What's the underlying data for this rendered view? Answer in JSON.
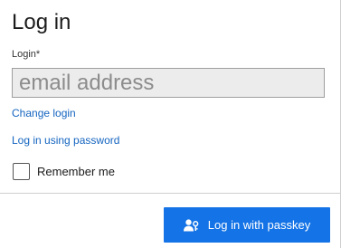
{
  "form": {
    "title": "Log in",
    "login_label": "Login*",
    "login_value": "",
    "login_placeholder": "email address",
    "change_login_link": "Change login",
    "password_link": "Log in using password",
    "remember_me_label": "Remember me",
    "remember_me_checked": false
  },
  "footer": {
    "passkey_button_label": "Log in with passkey",
    "passkey_icon": "passkey-icon"
  },
  "colors": {
    "accent": "#1473e6",
    "link": "#1565c0"
  }
}
